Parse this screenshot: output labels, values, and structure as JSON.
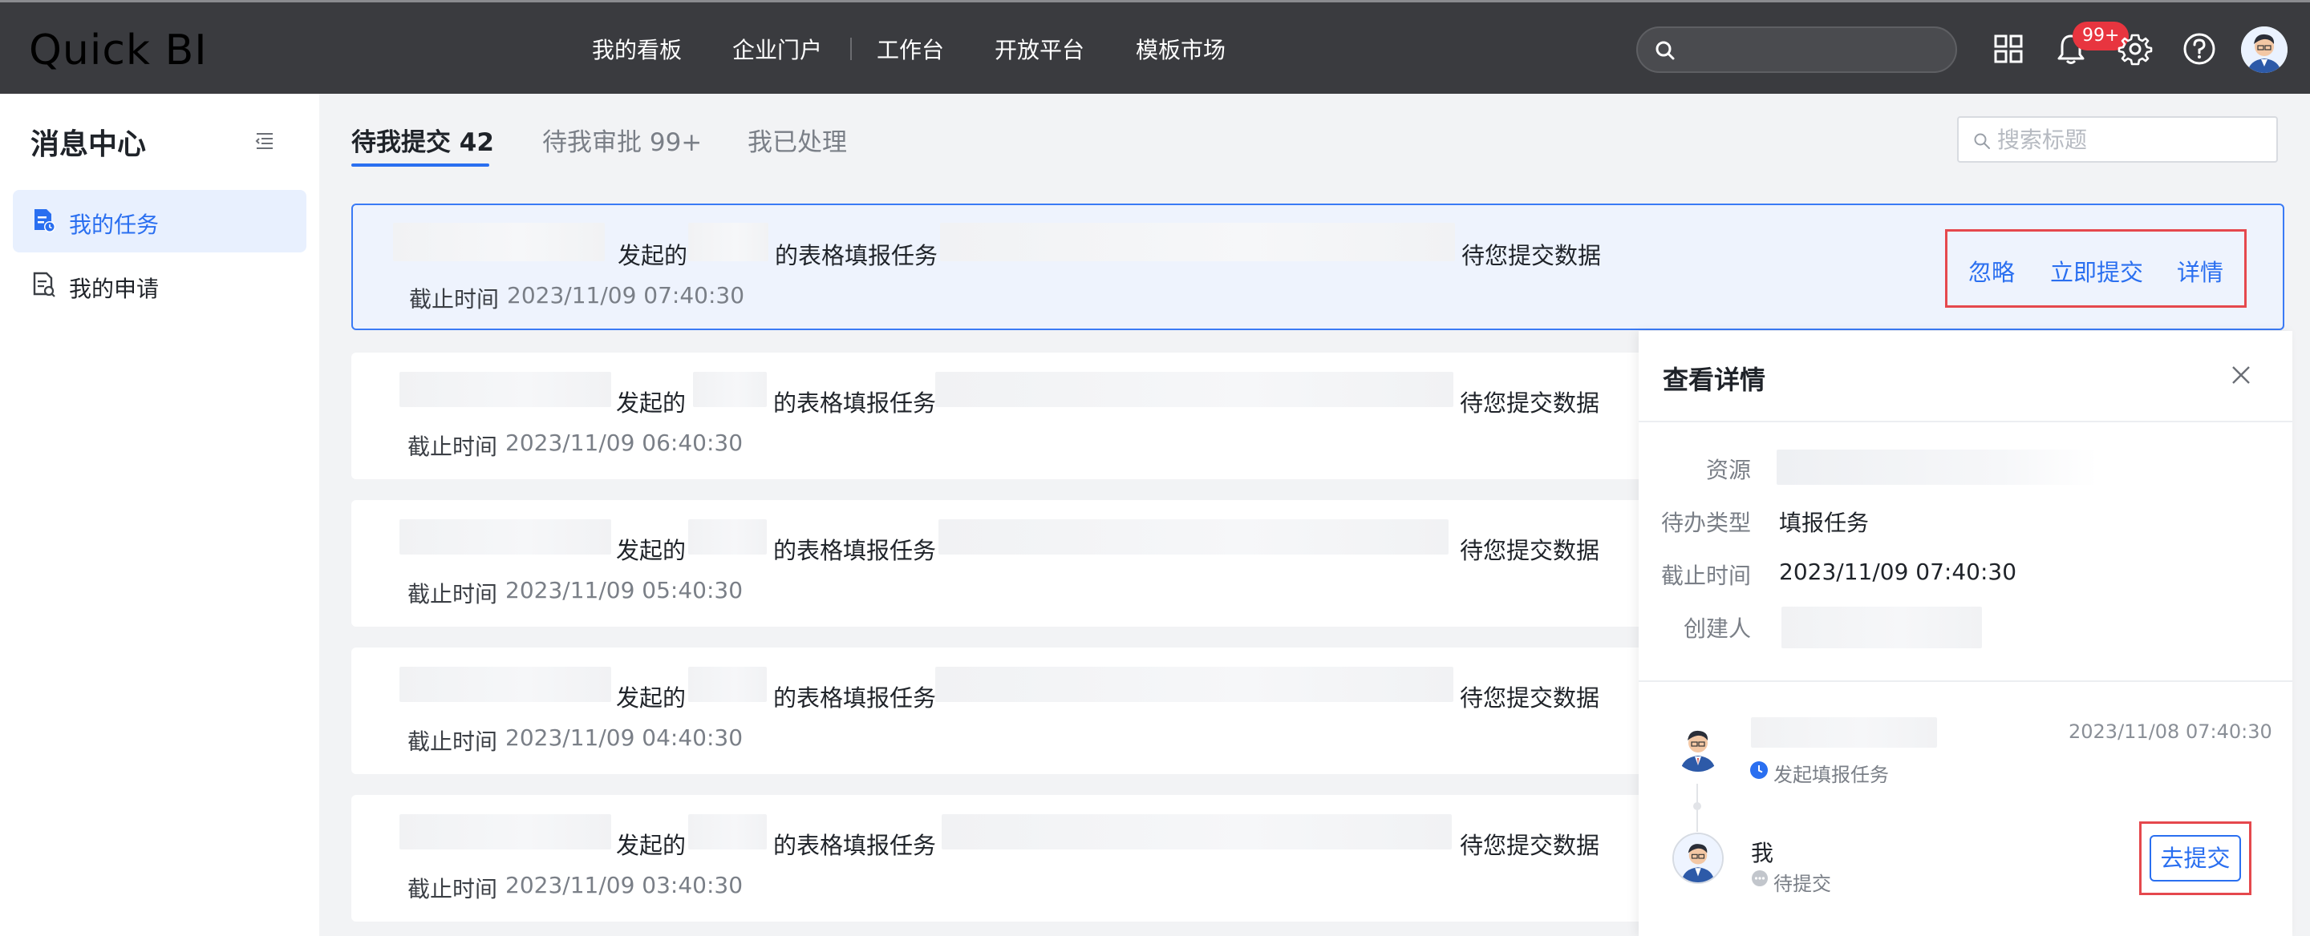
{
  "app": {
    "title": "Quick BI"
  },
  "nav": [
    "我的看板",
    "企业门户",
    "工作台",
    "开放平台",
    "模板市场"
  ],
  "header": {
    "notification_count": "99+",
    "icons": [
      "apps-grid-icon",
      "bell-icon",
      "gear-icon",
      "help-icon",
      "avatar"
    ]
  },
  "sidebar": {
    "title": "消息中心",
    "items": [
      {
        "label": "我的任务",
        "icon": "task-doc-icon",
        "active": true
      },
      {
        "label": "我的申请",
        "icon": "apply-doc-icon",
        "active": false
      }
    ]
  },
  "tabs": [
    {
      "label": "待我提交 42",
      "active": true
    },
    {
      "label": "待我审批 99+",
      "active": false
    },
    {
      "label": "我已处理",
      "active": false
    }
  ],
  "search": {
    "placeholder": "搜索标题"
  },
  "tasks": [
    {
      "initiated": "发起的",
      "task_type": "的表格填报任务",
      "status": "待您提交数据",
      "deadline_label": "截止时间",
      "deadline": "2023/11/09 07:40:30",
      "actions": [
        "忽略",
        "立即提交",
        "详情"
      ]
    },
    {
      "initiated": "发起的",
      "task_type": "的表格填报任务",
      "status": "待您提交数据",
      "deadline_label": "截止时间",
      "deadline": "2023/11/09 06:40:30"
    },
    {
      "initiated": "发起的",
      "task_type": "的表格填报任务",
      "status": "待您提交数据",
      "deadline_label": "截止时间",
      "deadline": "2023/11/09 05:40:30"
    },
    {
      "initiated": "发起的",
      "task_type": "的表格填报任务",
      "status": "待您提交数据",
      "deadline_label": "截止时间",
      "deadline": "2023/11/09 04:40:30"
    },
    {
      "initiated": "发起的",
      "task_type": "的表格填报任务",
      "status": "待您提交数据",
      "deadline_label": "截止时间",
      "deadline": "2023/11/09 03:40:30"
    }
  ],
  "detail": {
    "title": "查看详情",
    "fields": {
      "resource_label": "资源",
      "type_label": "待办类型",
      "type_value": "填报任务",
      "deadline_label": "截止时间",
      "deadline_value": "2023/11/09 07:40:30",
      "creator_label": "创建人"
    },
    "timeline": [
      {
        "time": "2023/11/08 07:40:30",
        "status": "发起填报任务"
      },
      {
        "name": "我",
        "status": "待提交",
        "button": "去提交"
      }
    ]
  },
  "colors": {
    "accent": "#2a6ff0",
    "highlight_box": "#e5484d",
    "topbar": "#3a3b3f",
    "badge": "#e8353f"
  }
}
